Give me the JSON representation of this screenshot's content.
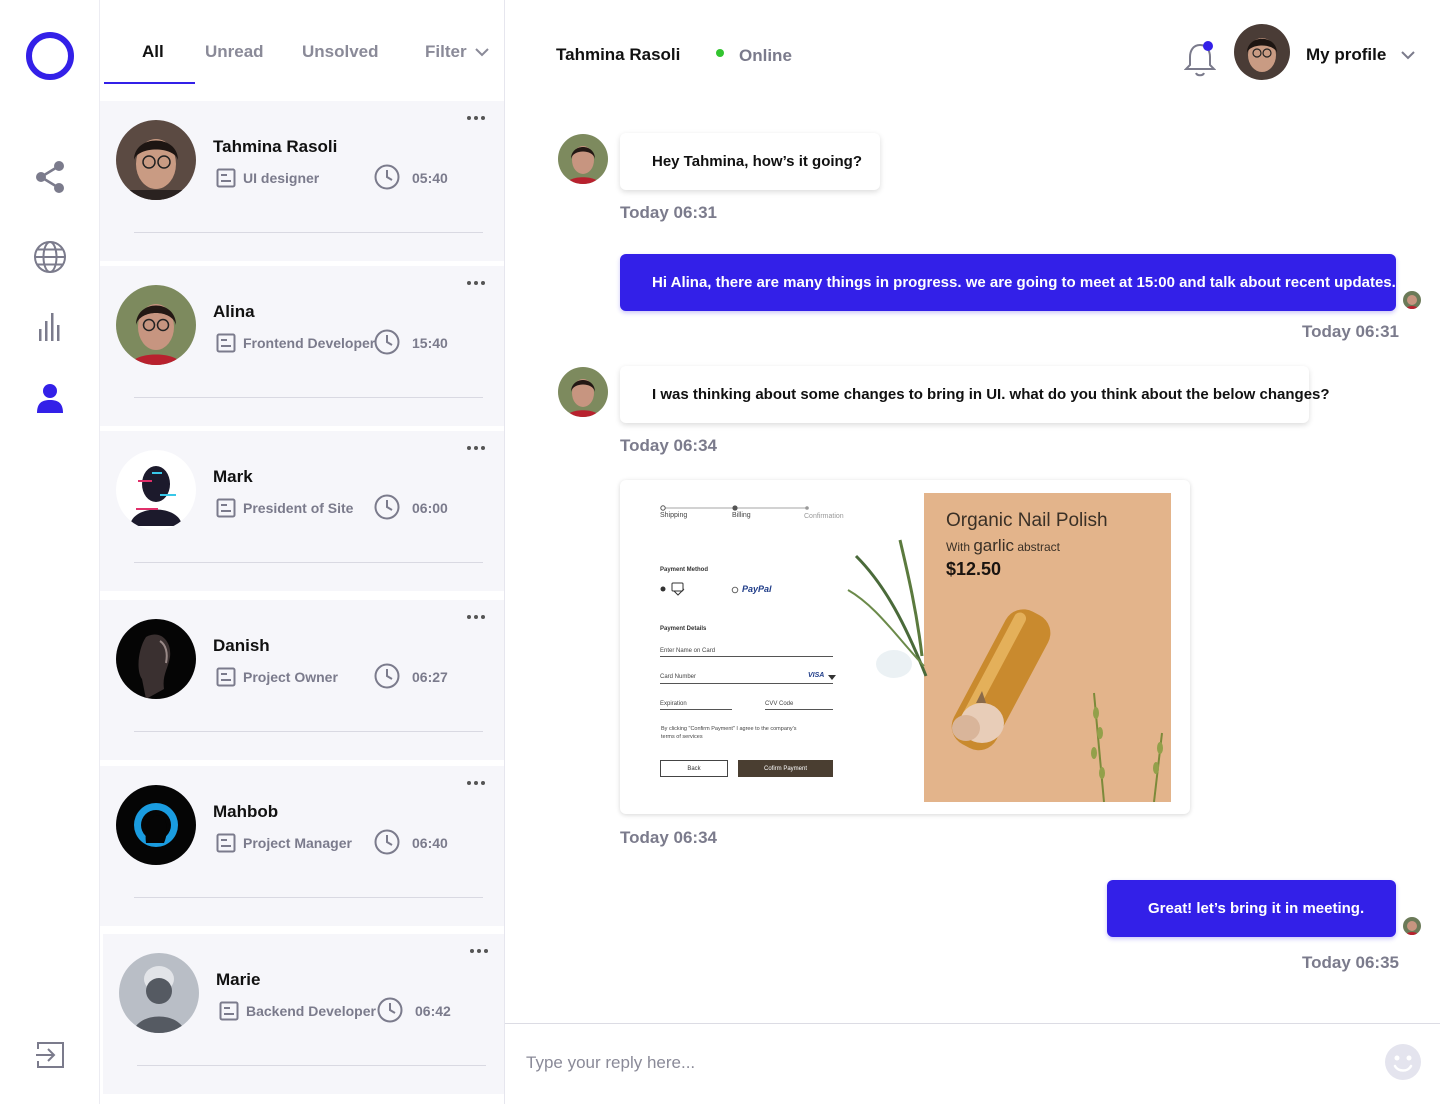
{
  "tabs": {
    "all": "All",
    "unread": "Unread",
    "unsolved": "Unsolved",
    "filter": "Filter"
  },
  "conversations": [
    {
      "name": "Tahmina Rasoli",
      "role": "UI designer",
      "time": "05:40"
    },
    {
      "name": "Alina",
      "role": "Frontend Developer",
      "time": "15:40"
    },
    {
      "name": "Mark",
      "role": "President of Site",
      "time": "06:00"
    },
    {
      "name": "Danish",
      "role": "Project Owner",
      "time": "06:27"
    },
    {
      "name": "Mahbob",
      "role": "Project Manager",
      "time": "06:40"
    },
    {
      "name": "Marie",
      "role": "Backend Developer",
      "time": "06:42"
    }
  ],
  "header": {
    "contact_name": "Tahmina Rasoli",
    "status": "Online",
    "profile_label": "My profile"
  },
  "messages": [
    {
      "direction": "in",
      "text": "Hey Tahmina, how’s it going?",
      "timestamp": "Today 06:31"
    },
    {
      "direction": "out",
      "text": "Hi Alina, there are many things in progress. we are going to meet at 15:00 and talk about recent updates.",
      "timestamp": "Today 06:31"
    },
    {
      "direction": "in",
      "text": "I was thinking about some changes to bring in UI. what do you think about the below changes?",
      "timestamp": "Today 06:34"
    },
    {
      "direction": "in",
      "type": "image",
      "timestamp": "Today 06:34"
    },
    {
      "direction": "out",
      "text": "Great! let’s bring it in meeting.",
      "timestamp": "Today 06:35"
    }
  ],
  "attachment": {
    "steps": [
      "Shipping",
      "Billing",
      "Confirmation"
    ],
    "payment_method_label": "Payment Method",
    "paypal_label": "PayPal",
    "payment_details_label": "Payment Details",
    "name_on_card": "Enter Name on Card",
    "card_number": "Card Number",
    "card_brand": "VISA",
    "expiration": "Expiration",
    "cvv": "CVV Code",
    "terms": "By clicking \"Confirm Payment\" I agree to the company's terms of services",
    "back_button": "Back",
    "confirm_button": "Cofirm Payment",
    "product_title": "Organic Nail Polish",
    "product_sub_prefix": "With",
    "product_sub_emph": "garlic",
    "product_sub_suffix": "abstract",
    "product_price": "$12.50"
  },
  "reply": {
    "placeholder": "Type your reply here..."
  },
  "colors": {
    "accent": "#3320e8",
    "online": "#32c42f",
    "muted_text": "#7b7b8c",
    "list_background": "#f6f6fa"
  }
}
